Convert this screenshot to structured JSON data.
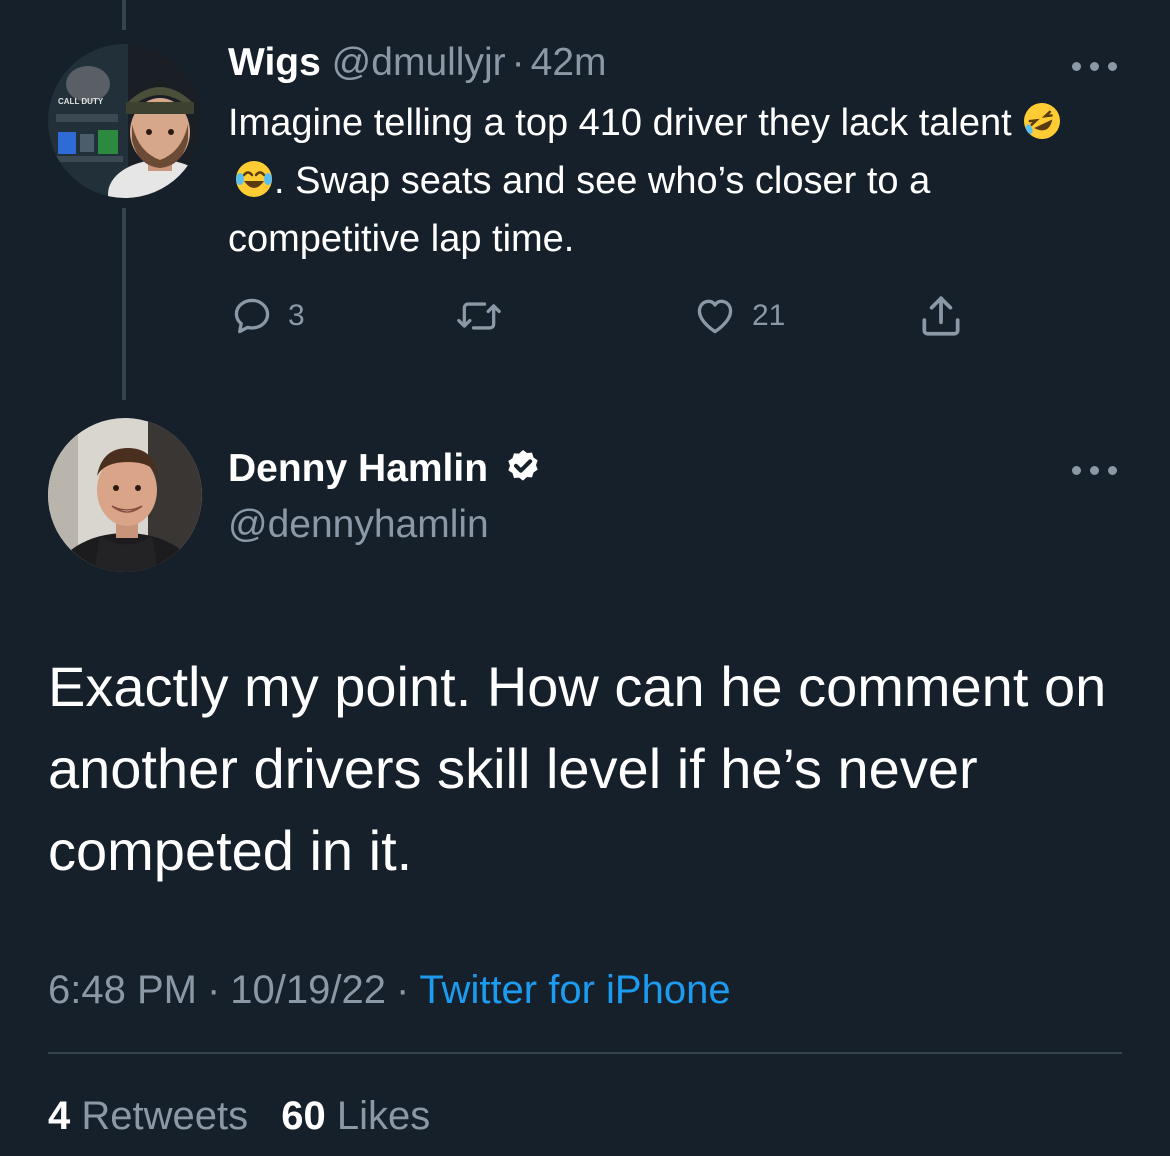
{
  "reply_tweet": {
    "name": "Wigs",
    "handle": "@dmullyjr",
    "separator": "·",
    "time": "42m",
    "text_part1": "Imagine telling a top 410 driver they lack talent",
    "emoji_1": "rolling-on-floor-laughing-emoji",
    "emoji_2": "face-with-tears-of-joy-emoji",
    "text_part2": ". Swap seats and see who’s closer to a competitive lap time.",
    "avatar_text": "CALL DUTY",
    "actions": {
      "reply_count": "3",
      "retweet_count": "",
      "like_count": "21"
    }
  },
  "main_tweet": {
    "name": "Denny Hamlin",
    "handle": "@dennyhamlin",
    "verified": true,
    "text": "Exactly my point. How can he comment on another drivers skill level if he’s never competed in it.",
    "time": "6:48 PM",
    "separator": "·",
    "date": "10/19/22",
    "source": "Twitter for iPhone",
    "retweets_count": "4",
    "retweets_label": "Retweets",
    "likes_count": "60",
    "likes_label": "Likes"
  },
  "icons": {
    "reply": "speech-bubble-icon",
    "retweet": "retweet-icon",
    "like": "heart-icon",
    "share": "share-icon",
    "more": "more-dots-icon",
    "verified": "verified-badge-icon"
  },
  "colors": {
    "background": "#15202b",
    "secondary_text": "#8b98a5",
    "link": "#1d9bf0",
    "divider": "#38444d",
    "thread_line": "#38444d"
  }
}
